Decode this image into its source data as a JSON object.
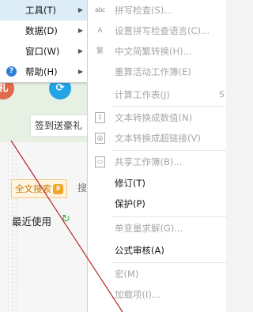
{
  "left_menu": {
    "items": [
      {
        "label": "工具(T)",
        "has_submenu": true,
        "highlighted": true
      },
      {
        "label": "数据(D)",
        "has_submenu": true
      },
      {
        "label": "窗口(W)",
        "has_submenu": true
      },
      {
        "label": "帮助(H)",
        "has_submenu": true,
        "icon": "help-icon"
      }
    ]
  },
  "background": {
    "gift_icon_text": "礼",
    "signin_text": "签到送豪礼",
    "search_pill_label": "全文搜索",
    "search_pill_crown": "♛",
    "search_cut_text": "搜",
    "recent_label": "最近使用",
    "refresh_icon": "↻"
  },
  "submenu": {
    "items": [
      {
        "label": "拼写检查(S)...",
        "enabled": false,
        "icon": "spellcheck-icon",
        "icon_text": "abc"
      },
      {
        "label": "设置拼写检查语言(C)...",
        "enabled": false,
        "icon": "language-icon",
        "icon_text": "A"
      },
      {
        "label": "中文简繁转换(H)...",
        "enabled": false,
        "icon": "chinese-convert-icon",
        "icon_text": "繁"
      },
      {
        "label": "重算活动工作簿(E)",
        "enabled": false
      },
      {
        "label": "计算工作表(J)",
        "enabled": false,
        "shortcut": "S"
      },
      {
        "label": "文本转换成数值(N)",
        "enabled": false,
        "icon": "text-to-number-icon",
        "icon_text": "1"
      },
      {
        "label": "文本转换成超链接(V)",
        "enabled": false,
        "icon": "text-to-link-icon",
        "icon_text": "@"
      },
      {
        "label": "共享工作簿(B)...",
        "enabled": false,
        "icon": "share-workbook-icon",
        "icon_text": "▭"
      },
      {
        "label": "修订(T)",
        "enabled": true
      },
      {
        "label": "保护(P)",
        "enabled": true
      },
      {
        "label": "单变量求解(G)...",
        "enabled": false
      },
      {
        "label": "公式审核(A)",
        "enabled": true
      },
      {
        "label": "宏(M)",
        "enabled": false
      },
      {
        "label": "加载项(I)...",
        "enabled": false
      }
    ]
  },
  "colors": {
    "highlight": "#dcedf7",
    "disabled_text": "#a6a6a6",
    "accent_red": "#b3262b"
  }
}
